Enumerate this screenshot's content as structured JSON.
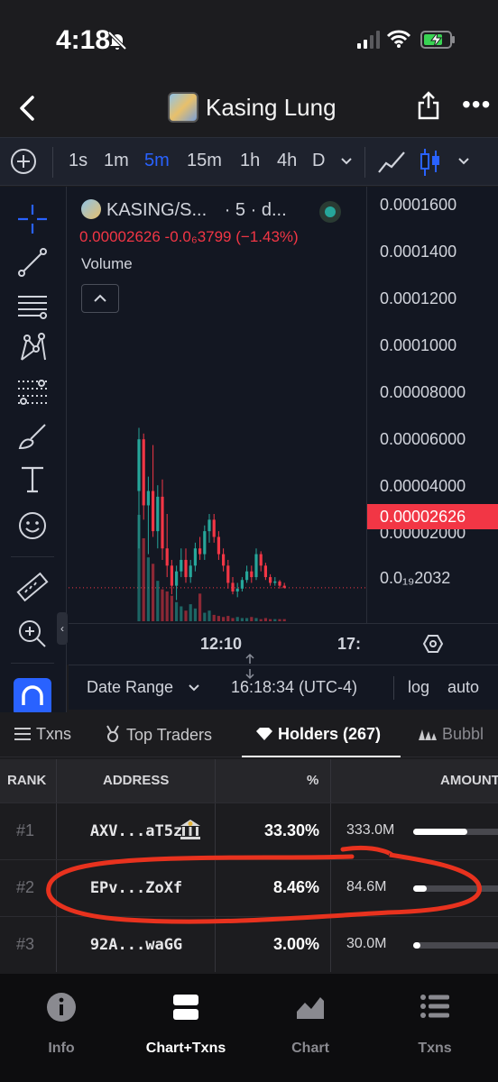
{
  "status": {
    "time": "4:18"
  },
  "header": {
    "title": "Kasing Lung"
  },
  "timeframes": {
    "items": [
      "1s",
      "1m",
      "5m",
      "15m",
      "1h",
      "4h",
      "D"
    ],
    "active": "5m"
  },
  "chart_legend": {
    "symbol": "KASING/S...",
    "interval": "· 5 · d...",
    "price_line": "0.00002626 -0.0₆3799 (−1.43%)",
    "volume_label": "Volume"
  },
  "chart_data": {
    "type": "candlestick",
    "price_axis_labels": [
      "0.0001600",
      "0.0001400",
      "0.0001200",
      "0.0001000",
      "0.00008000",
      "0.00006000",
      "0.00004000",
      "0.00002000",
      "0.0₁₉2032"
    ],
    "current_price_label": "0.00002626",
    "time_axis_labels": [
      "12:10",
      "17:"
    ],
    "candles": [
      {
        "o": 6e-05,
        "h": 8.2e-05,
        "l": 4e-05,
        "c": 7.8e-05
      },
      {
        "o": 7.8e-05,
        "h": 8e-05,
        "l": 5e-05,
        "c": 5.5e-05
      },
      {
        "o": 5.5e-05,
        "h": 6.5e-05,
        "l": 3.8e-05,
        "c": 6e-05
      },
      {
        "o": 6e-05,
        "h": 7.6e-05,
        "l": 4.4e-05,
        "c": 4.6e-05
      },
      {
        "o": 4.6e-05,
        "h": 6.2e-05,
        "l": 4e-05,
        "c": 5.8e-05
      },
      {
        "o": 5.8e-05,
        "h": 6.4e-05,
        "l": 3.6e-05,
        "c": 4e-05
      },
      {
        "o": 4e-05,
        "h": 5.2e-05,
        "l": 3e-05,
        "c": 3.4e-05
      },
      {
        "o": 3.4e-05,
        "h": 3.6e-05,
        "l": 2.4e-05,
        "c": 2.7e-05
      },
      {
        "o": 2.7e-05,
        "h": 3.4e-05,
        "l": 2.2e-05,
        "c": 3.2e-05
      },
      {
        "o": 3.2e-05,
        "h": 4e-05,
        "l": 3e-05,
        "c": 3.6e-05
      },
      {
        "o": 3.6e-05,
        "h": 4e-05,
        "l": 2.8e-05,
        "c": 3e-05
      },
      {
        "o": 3e-05,
        "h": 3.6e-05,
        "l": 2.8e-05,
        "c": 3.4e-05
      },
      {
        "o": 3.4e-05,
        "h": 4.2e-05,
        "l": 3.2e-05,
        "c": 4e-05
      },
      {
        "o": 4e-05,
        "h": 4.4e-05,
        "l": 3.6e-05,
        "c": 3.8e-05
      },
      {
        "o": 3.8e-05,
        "h": 4.8e-05,
        "l": 3.6e-05,
        "c": 4.6e-05
      },
      {
        "o": 4.6e-05,
        "h": 5.2e-05,
        "l": 4.2e-05,
        "c": 5e-05
      },
      {
        "o": 5e-05,
        "h": 5.2e-05,
        "l": 4.2e-05,
        "c": 4.4e-05
      },
      {
        "o": 4.4e-05,
        "h": 4.6e-05,
        "l": 3.6e-05,
        "c": 3.8e-05
      },
      {
        "o": 3.8e-05,
        "h": 4e-05,
        "l": 3.2e-05,
        "c": 3.4e-05
      },
      {
        "o": 3.4e-05,
        "h": 3.6e-05,
        "l": 2.6e-05,
        "c": 2.8e-05
      },
      {
        "o": 2.8e-05,
        "h": 3e-05,
        "l": 2.4e-05,
        "c": 2.5e-05
      },
      {
        "o": 2.5e-05,
        "h": 2.8e-05,
        "l": 2.3e-05,
        "c": 2.6e-05
      },
      {
        "o": 2.6e-05,
        "h": 3e-05,
        "l": 2.5e-05,
        "c": 2.9e-05
      },
      {
        "o": 2.9e-05,
        "h": 3.4e-05,
        "l": 2.8e-05,
        "c": 3.2e-05
      },
      {
        "o": 3.2e-05,
        "h": 3.4e-05,
        "l": 2.8e-05,
        "c": 3e-05
      },
      {
        "o": 3e-05,
        "h": 4e-05,
        "l": 2.9e-05,
        "c": 3.8e-05
      },
      {
        "o": 3.8e-05,
        "h": 3.9e-05,
        "l": 3.2e-05,
        "c": 3.4e-05
      },
      {
        "o": 3.4e-05,
        "h": 3.5e-05,
        "l": 2.9e-05,
        "c": 3e-05
      },
      {
        "o": 3e-05,
        "h": 3.1e-05,
        "l": 2.7e-05,
        "c": 2.8e-05
      },
      {
        "o": 2.8e-05,
        "h": 3e-05,
        "l": 2.7e-05,
        "c": 2.85e-05
      },
      {
        "o": 2.85e-05,
        "h": 2.9e-05,
        "l": 2.6e-05,
        "c": 2.7e-05
      },
      {
        "o": 2.7e-05,
        "h": 2.8e-05,
        "l": 2.6e-05,
        "c": 2.63e-05
      }
    ],
    "volumes": [
      100,
      78,
      60,
      54,
      38,
      30,
      28,
      24,
      18,
      14,
      10,
      16,
      12,
      26,
      8,
      10,
      6,
      5,
      4,
      5,
      3,
      4,
      3,
      3,
      4,
      3,
      2,
      3,
      2,
      2,
      2,
      2
    ],
    "y_range": [
      1.4e-05,
      0.000166
    ]
  },
  "rangebar": {
    "date_range": "Date Range",
    "time": "16:18:34 (UTC-4)",
    "log": "log",
    "auto": "auto"
  },
  "tabs": {
    "txns": "Txns",
    "top_traders": "Top Traders",
    "holders": "Holders (267)",
    "bubble": "Bubbl"
  },
  "table": {
    "headers": {
      "rank": "RANK",
      "address": "ADDRESS",
      "pct": "%",
      "amount": "AMOUNT"
    },
    "rows": [
      {
        "rank": "#1",
        "address": "AXV...aT5z",
        "pct": "33.30%",
        "amount": "333.0M",
        "share": 0.333
      },
      {
        "rank": "#2",
        "address": "EPv...ZoXf",
        "pct": "8.46%",
        "amount": "84.6M",
        "share": 0.0846
      },
      {
        "rank": "#3",
        "address": "92A...waGG",
        "pct": "3.00%",
        "amount": "30.0M",
        "share": 0.03
      }
    ]
  },
  "bottom_nav": {
    "info": "Info",
    "chart_txns": "Chart+Txns",
    "chart": "Chart",
    "txns": "Txns"
  },
  "colors": {
    "up": "#26a69a",
    "down": "#f23645",
    "accent": "#2962ff",
    "annotation": "#e8321e"
  }
}
